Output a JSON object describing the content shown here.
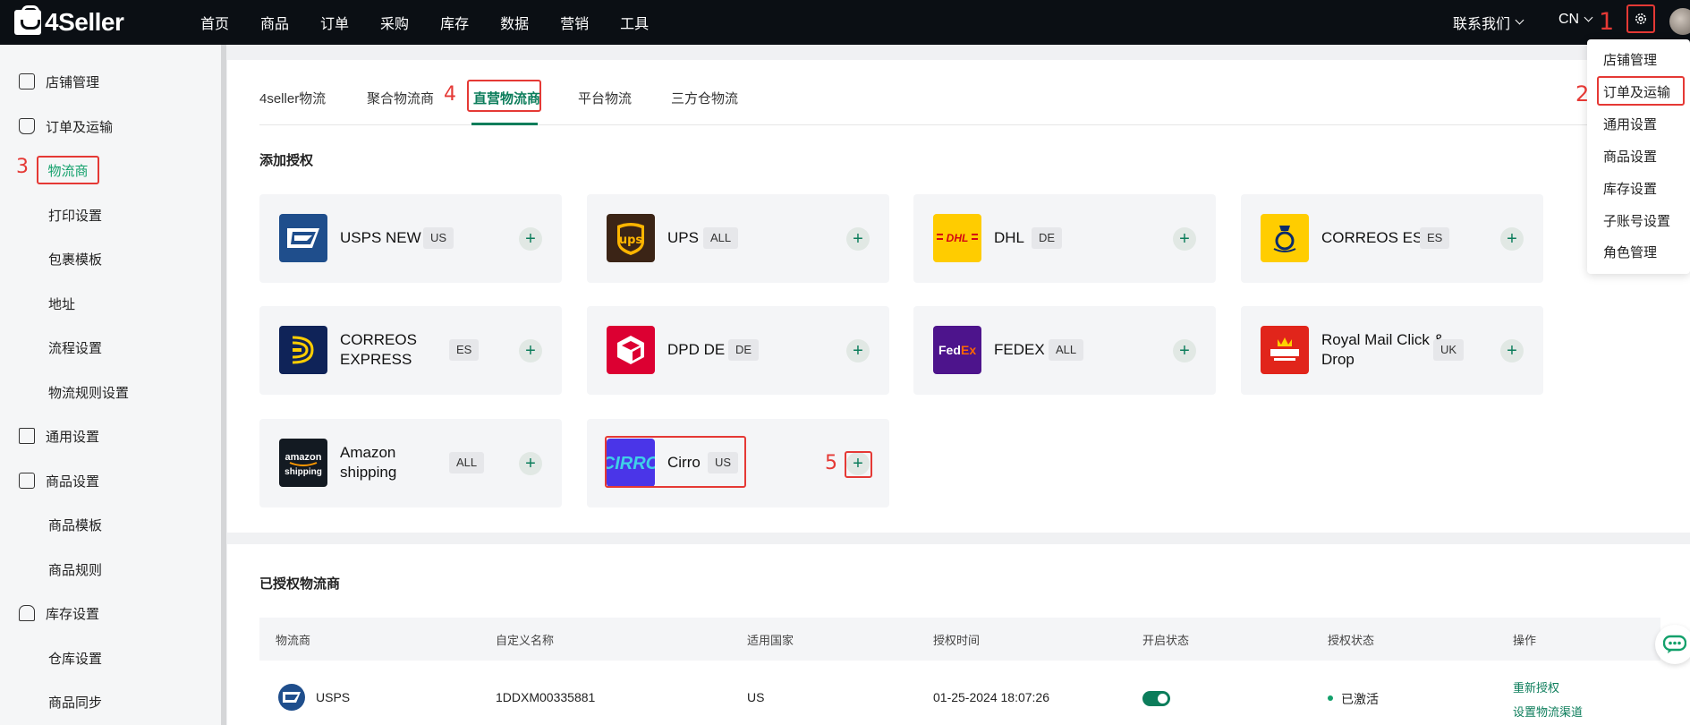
{
  "brand": {
    "name": "4Seller"
  },
  "nav": [
    "首页",
    "商品",
    "订单",
    "采购",
    "库存",
    "数据",
    "营销",
    "工具"
  ],
  "header": {
    "contact": "联系我们",
    "language": "CN"
  },
  "annotations": [
    "1",
    "2",
    "3",
    "4",
    "5"
  ],
  "settings_menu": [
    "店铺管理",
    "订单及运输",
    "通用设置",
    "商品设置",
    "库存设置",
    "子账号设置",
    "角色管理"
  ],
  "sidebar": {
    "items": [
      {
        "label": "店铺管理",
        "icon": "store-icon"
      },
      {
        "label": "订单及运输",
        "icon": "order-icon"
      },
      {
        "label": "物流商",
        "active": true
      },
      {
        "label": "打印设置"
      },
      {
        "label": "包裹模板"
      },
      {
        "label": "地址"
      },
      {
        "label": "流程设置"
      },
      {
        "label": "物流规则设置"
      },
      {
        "label": "通用设置",
        "icon": "general-icon"
      },
      {
        "label": "商品设置",
        "icon": "product-icon"
      },
      {
        "label": "商品模板"
      },
      {
        "label": "商品规则"
      },
      {
        "label": "库存设置",
        "icon": "inventory-icon"
      },
      {
        "label": "仓库设置"
      },
      {
        "label": "商品同步"
      }
    ]
  },
  "tabs": [
    "4seller物流",
    "聚合物流商",
    "直营物流商",
    "平台物流",
    "三方仓物流"
  ],
  "active_tab": "直营物流商",
  "add_auth": {
    "title": "添加授权",
    "carriers": [
      {
        "name": "USPS NEW",
        "region": "US",
        "logo_text": "USPS"
      },
      {
        "name": "UPS",
        "region": "ALL",
        "logo_text": "ups"
      },
      {
        "name": "DHL",
        "region": "DE",
        "logo_text": "DHL"
      },
      {
        "name": "CORREOS ES",
        "region": "ES",
        "logo_text": ""
      },
      {
        "name": "CORREOS EXPRESS",
        "region": "ES",
        "logo_text": ""
      },
      {
        "name": "DPD DE",
        "region": "DE",
        "logo_text": ""
      },
      {
        "name": "FEDEX",
        "region": "ALL",
        "logo_text": "FedEx"
      },
      {
        "name": "Royal Mail Click & Drop",
        "region": "UK",
        "logo_text": "Royal Mail"
      },
      {
        "name": "Amazon shipping",
        "region": "ALL",
        "logo_text": "amazon shipping"
      },
      {
        "name": "Cirro",
        "region": "US",
        "logo_text": "CIRRO"
      }
    ],
    "add_symbol": "+"
  },
  "authorized": {
    "title": "已授权物流商",
    "columns": [
      "物流商",
      "自定义名称",
      "适用国家",
      "授权时间",
      "开启状态",
      "授权状态",
      "操作"
    ],
    "rows": [
      {
        "carrier": "USPS",
        "custom_name": "1DDXM00335881",
        "country": "US",
        "auth_time": "01-25-2024 18:07:26",
        "enabled": true,
        "auth_status": "已激活",
        "actions": [
          "重新授权",
          "设置物流渠道"
        ]
      }
    ]
  },
  "colors": {
    "accent": "#0c7d5b",
    "annotation": "#e53935",
    "topbar": "#0b0f14"
  }
}
